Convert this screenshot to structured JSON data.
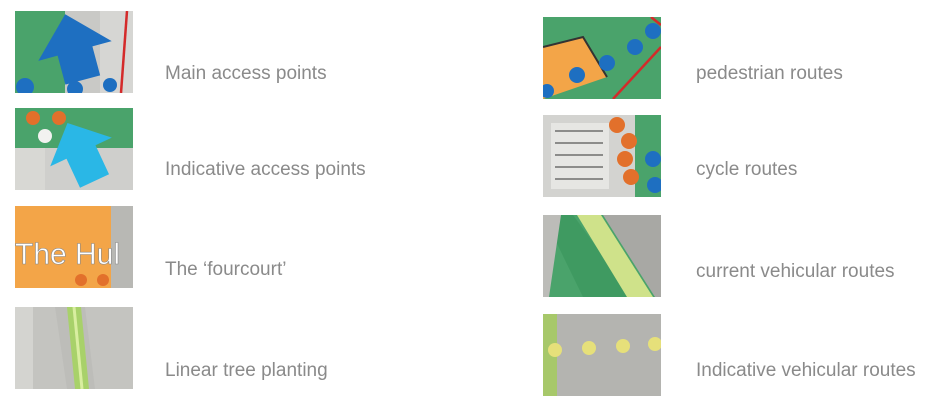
{
  "legend": {
    "left": [
      {
        "label": "Main access points",
        "icon": "blue-arrow-icon"
      },
      {
        "label": "Indicative access points",
        "icon": "light-blue-arrow-icon"
      },
      {
        "label": "The ‘fourcourt’",
        "icon": "orange-forecourt-icon",
        "thumb_text": "The Hul"
      },
      {
        "label": "Linear tree planting",
        "icon": "tree-line-icon"
      }
    ],
    "right": [
      {
        "label": "pedestrian routes",
        "icon": "pedestrian-route-icon"
      },
      {
        "label": "cycle routes",
        "icon": "cycle-route-icon"
      },
      {
        "label": "current vehicular routes",
        "icon": "vehicular-route-icon"
      },
      {
        "label": "Indicative vehicular routes",
        "icon": "indicative-vehicular-route-icon"
      }
    ]
  },
  "colors": {
    "label_text": "#8a8a8a",
    "route_blue": "#1e6fc1",
    "access_cyan": "#2ab7e6",
    "dot_orange": "#e2702b",
    "forecourt_orange": "#f3a548",
    "green": "#4aa36b",
    "road_grey": "#b8b8b4"
  }
}
